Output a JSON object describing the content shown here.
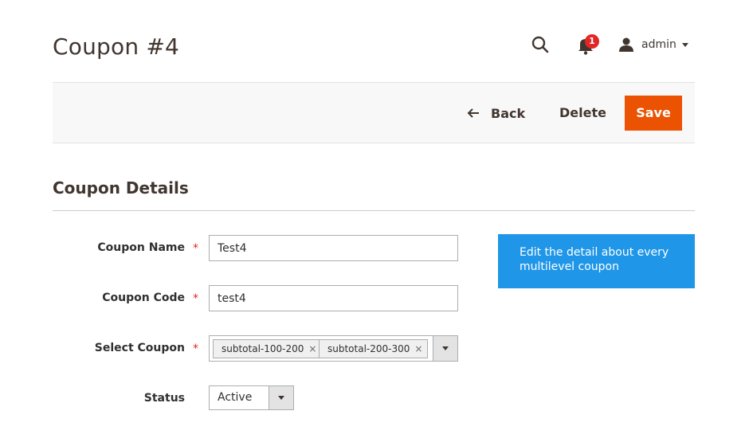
{
  "header": {
    "title": "Coupon #4",
    "notification_count": "1",
    "user_name": "admin"
  },
  "toolbar": {
    "back_label": "Back",
    "delete_label": "Delete",
    "save_label": "Save"
  },
  "section": {
    "title": "Coupon Details"
  },
  "form": {
    "coupon_name": {
      "label": "Coupon Name",
      "value": "Test4",
      "required_mark": "*"
    },
    "coupon_code": {
      "label": "Coupon Code",
      "value": "test4",
      "required_mark": "*"
    },
    "select_coupon": {
      "label": "Select Coupon",
      "required_mark": "*",
      "selected": [
        "subtotal-100-200",
        "subtotal-200-300"
      ],
      "remove_glyph": "×"
    },
    "status": {
      "label": "Status",
      "value": "Active"
    }
  },
  "info": {
    "text": "Edit the detail about every multilevel coupon"
  },
  "colors": {
    "save_button": "#eb5202",
    "info_box": "#1f96e8",
    "badge": "#e22626",
    "required": "#e22626",
    "toolbar_bg": "#f8f8f8"
  },
  "icons": {
    "search": "search-icon",
    "notifications": "bell-icon",
    "user": "user-icon",
    "back": "arrow-left-icon",
    "dropdown": "chevron-down-icon"
  }
}
